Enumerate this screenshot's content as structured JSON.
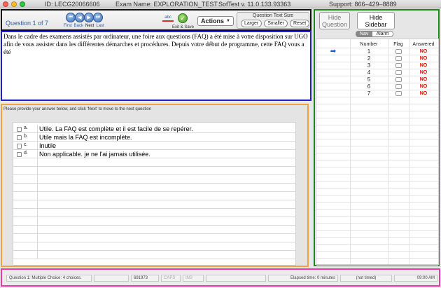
{
  "titlebar": {
    "id": "ID: LECG20066606",
    "exam": "Exam Name: EXPLORATION_TEST",
    "version": "SofTest v. 11.0.133.93363",
    "support": "Support: 866–429–8889",
    "colors": {
      "close": "#ff5f57",
      "minimize": "#febc2e",
      "zoom": "#28c840"
    }
  },
  "toolbar": {
    "question_counter": "Question 1 of 7",
    "nav_labels": [
      "First",
      "Back",
      "Next",
      "Last"
    ],
    "nav_icons": [
      "first-icon",
      "back-icon",
      "next-icon",
      "last-icon"
    ],
    "exit_label": "Exit & Save",
    "spell_label": "abc",
    "actions_label": "Actions",
    "text_size_title": "Question Text Size",
    "text_size_buttons": [
      "Larger",
      "Smaller",
      "Reset"
    ]
  },
  "question": {
    "text": "Dans le cadre des examens assistés par ordinateur, une foire aux questions (FAQ) a été mise à votre disposition sur UGO afin de vous assister dans les différentes démarches et procédures. Depuis votre début de programme, cette FAQ vous a été"
  },
  "answer": {
    "instruction": "Please provide your answer below, and click 'Next' to move to the next question",
    "choices": [
      {
        "letter": "a.",
        "text": "Utile. La FAQ est complète et il est facile de se repérer."
      },
      {
        "letter": "b.",
        "text": "Utile mais la FAQ est incomplète."
      },
      {
        "letter": "c.",
        "text": "Inutile"
      },
      {
        "letter": "d.",
        "text": "Non applicable. je ne l'ai jamais utilisée."
      }
    ]
  },
  "sidebar": {
    "hide_question": "Hide Question",
    "hide_sidebar": "Hide Sidebar",
    "tabs": [
      "Nav",
      "Alarm"
    ],
    "selected_tab": "Nav",
    "columns": [
      "Number",
      "Flag",
      "Answered"
    ],
    "rows": [
      {
        "number": "1",
        "answered": "NO",
        "current": true
      },
      {
        "number": "2",
        "answered": "NO",
        "current": false
      },
      {
        "number": "3",
        "answered": "NO",
        "current": false
      },
      {
        "number": "4",
        "answered": "NO",
        "current": false
      },
      {
        "number": "5",
        "answered": "NO",
        "current": false
      },
      {
        "number": "6",
        "answered": "NO",
        "current": false
      },
      {
        "number": "7",
        "answered": "NO",
        "current": false
      }
    ]
  },
  "status": {
    "question_type": "Question 1: Multiple Choice: 4 choices.",
    "count": "691973",
    "caps": "CAPS",
    "ins": "INS",
    "elapsed": "Elapsed time: 0 minutes",
    "timing": "(not timed)",
    "clock": "09:00 AM"
  }
}
